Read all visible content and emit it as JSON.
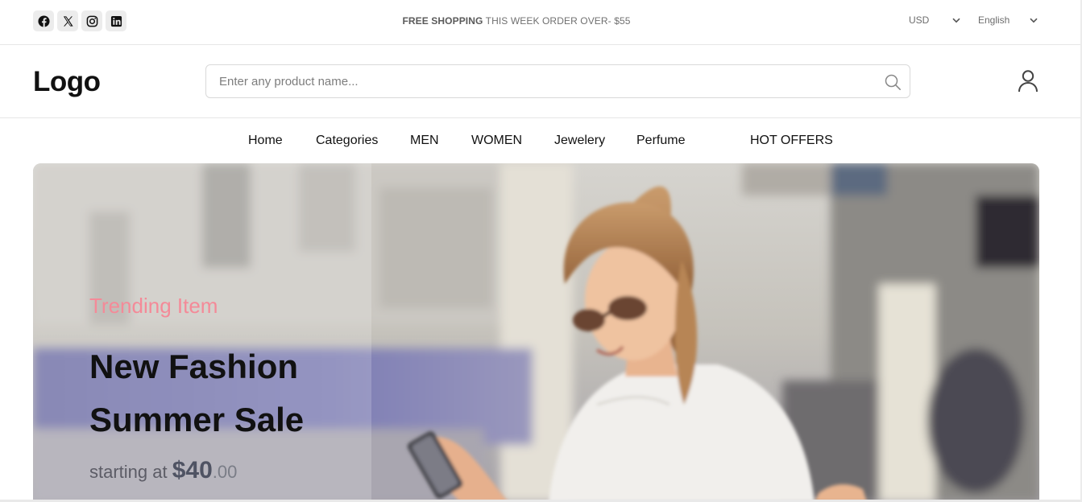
{
  "topbar": {
    "socials": [
      {
        "icon": "facebook-icon"
      },
      {
        "icon": "x-icon"
      },
      {
        "icon": "instagram-icon"
      },
      {
        "icon": "linkedin-icon"
      }
    ],
    "promo_bold": "FREE SHOPPING",
    "promo_rest": " THIS WEEK ORDER OVER- $55",
    "currency": "USD",
    "language": "English"
  },
  "header": {
    "logo": "Logo",
    "search_placeholder": "Enter any product name..."
  },
  "nav": {
    "items": [
      "Home",
      "Categories",
      "MEN",
      "WOMEN",
      "Jewelery",
      "Perfume",
      "HOT OFFERS"
    ]
  },
  "hero": {
    "subtitle": "Trending Item",
    "title": "New Fashion Summer Sale",
    "price_prefix": "starting at ",
    "price_amount": "$40",
    "price_cents": ".00",
    "colors": {
      "subtitle": "#f48a98",
      "title": "#111111"
    }
  }
}
